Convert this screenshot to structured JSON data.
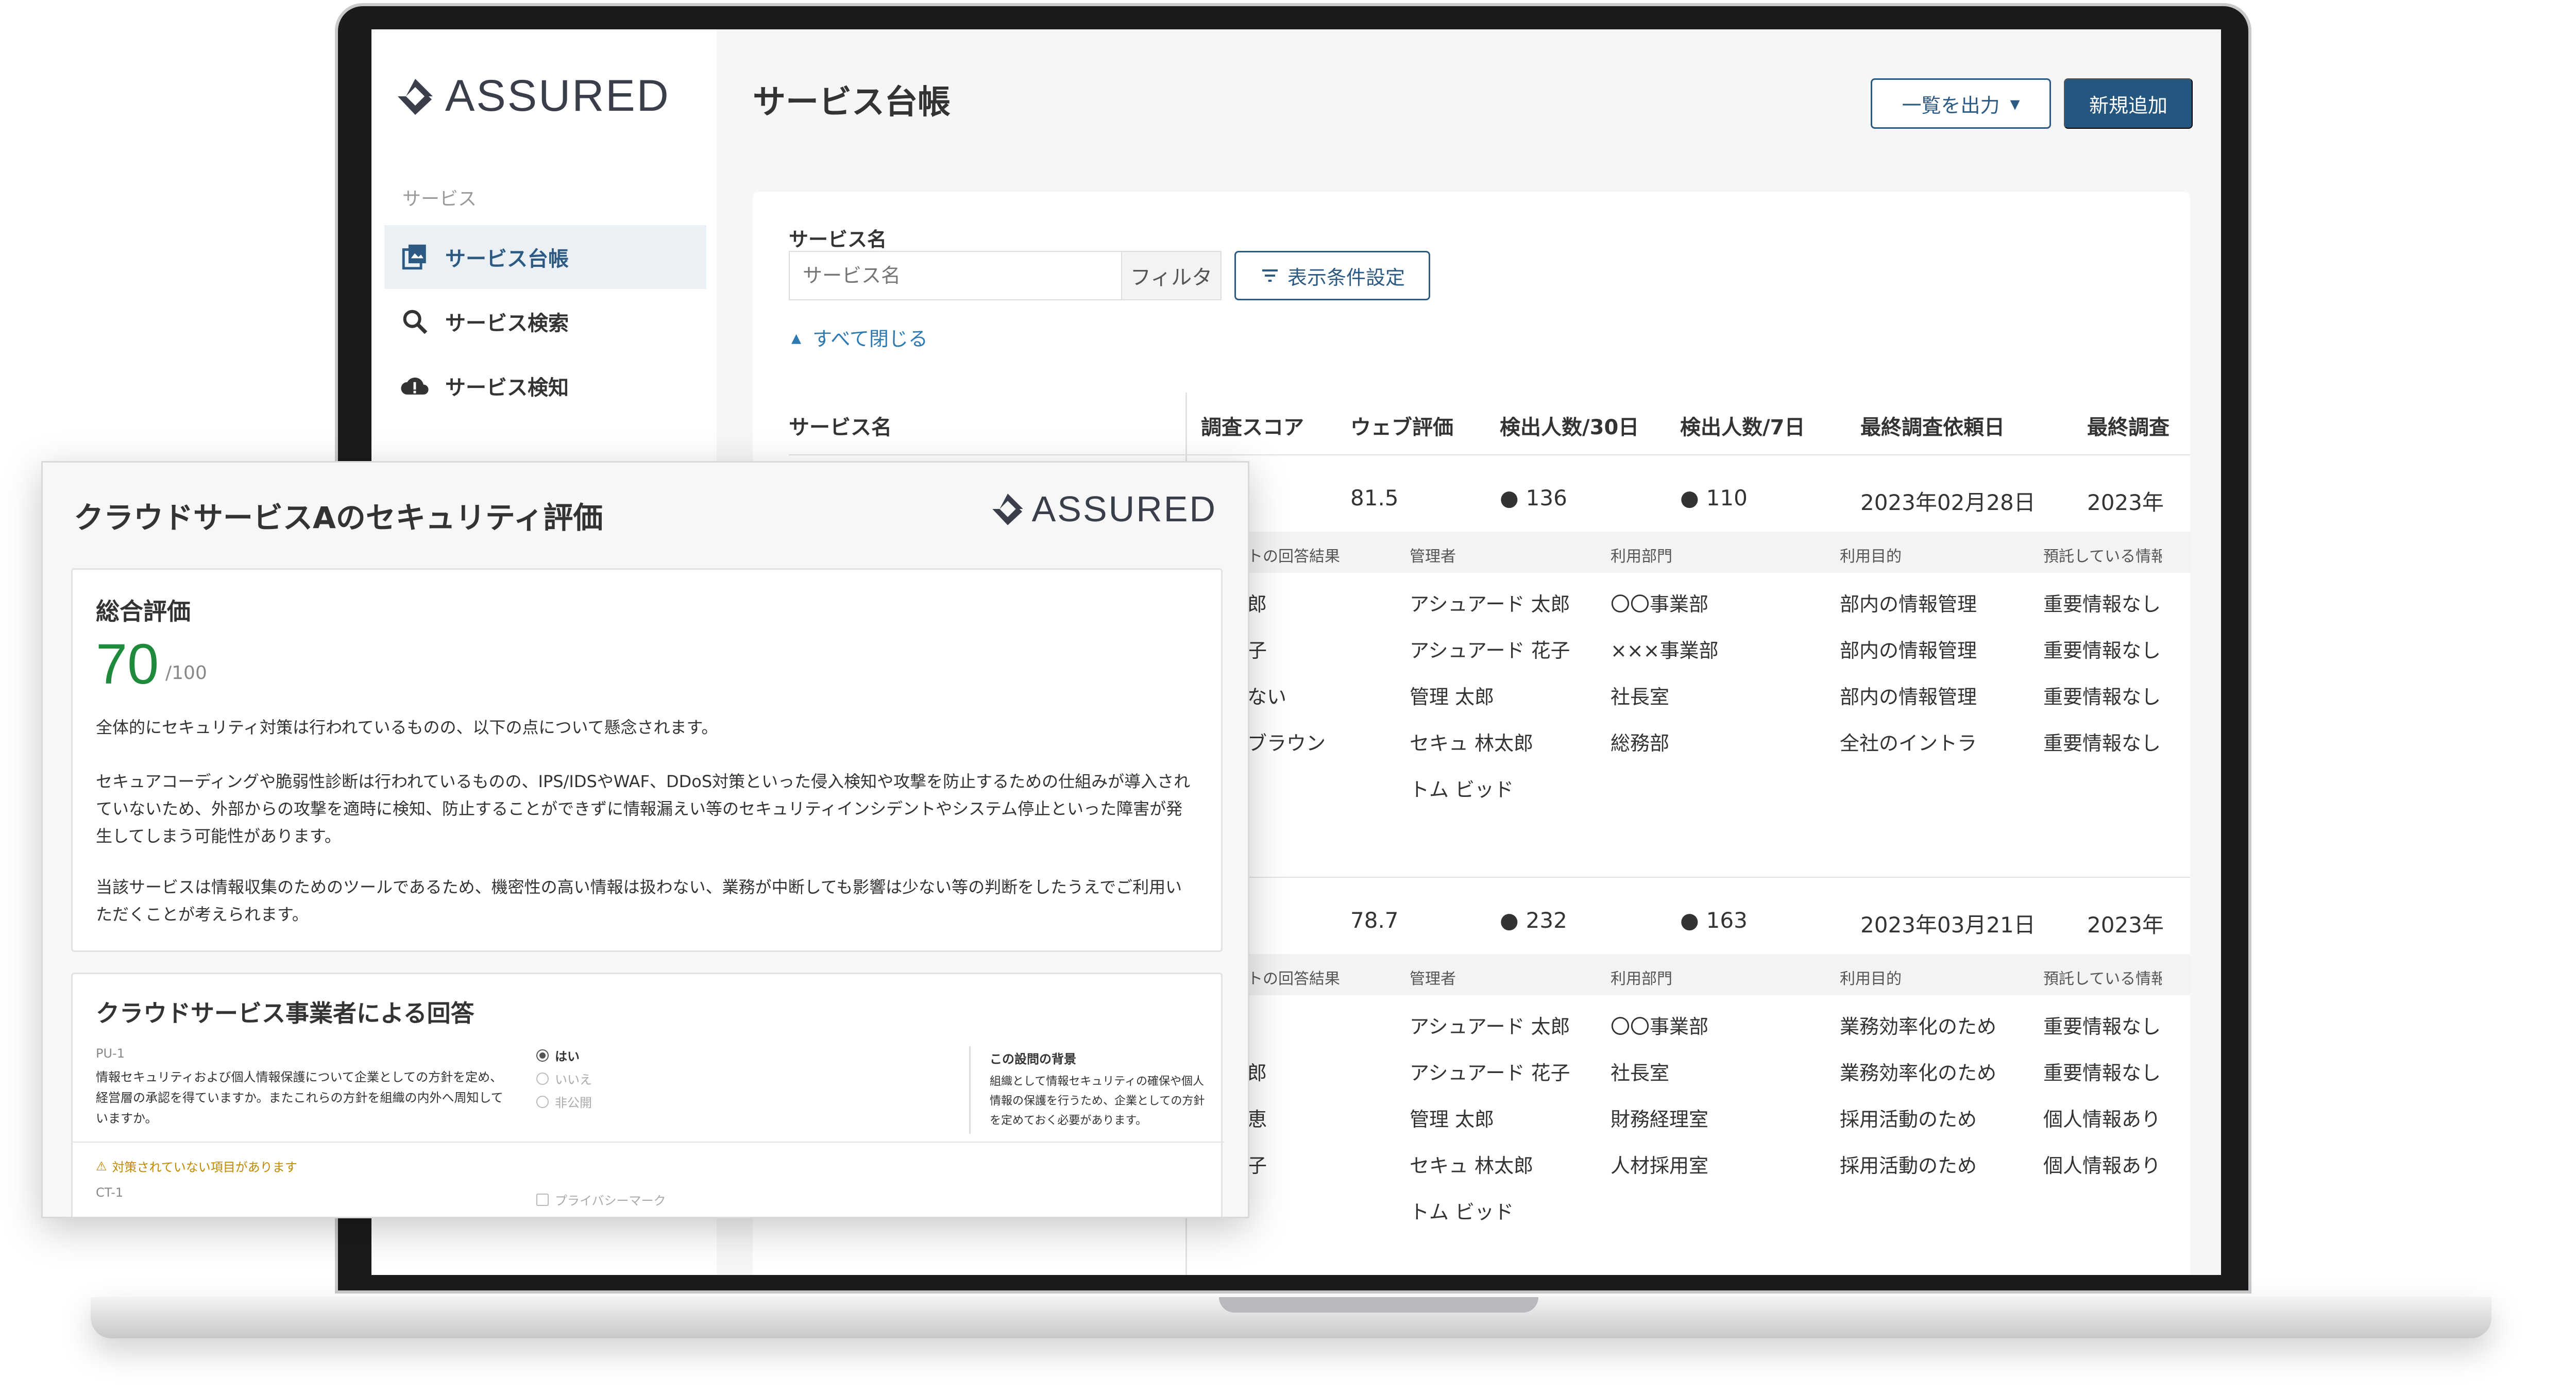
{
  "app": {
    "logo_text": "ASSURED",
    "accent_color": "#25567f",
    "success_color": "#1f8a3c"
  },
  "sidebar": {
    "section_label": "サービス",
    "items": [
      {
        "label": "サービス台帳",
        "icon": "ledger-icon",
        "active": true
      },
      {
        "label": "サービス検索",
        "icon": "search-icon",
        "active": false
      },
      {
        "label": "サービス検知",
        "icon": "cloud-alert-icon",
        "active": false
      }
    ]
  },
  "header": {
    "title": "サービス台帳",
    "export_label": "一覧を出力",
    "new_label": "新規追加"
  },
  "filter": {
    "label": "サービス名",
    "placeholder": "サービス名",
    "filter_button": "フィルタ",
    "display_settings": "表示条件設定",
    "collapse_all": "すべて閉じる"
  },
  "table": {
    "headers": [
      "サービス名",
      "調査スコア",
      "ウェブ評価",
      "検出人数/30日",
      "検出人数/7日",
      "最終調査依頼日",
      "最終調査"
    ],
    "rows": [
      {
        "web": "81.5",
        "det30": "136",
        "det7": "110",
        "last_request": "2023年02月28日",
        "last_survey": "2023年",
        "sub_headers": [
          "トの回答結果",
          "管理者",
          "利用部門",
          "利用目的",
          "預託している情報"
        ],
        "sub_rows": [
          [
            "郎",
            "アシュアード 太郎",
            "〇〇事業部",
            "部内の情報管理",
            "重要情報なし"
          ],
          [
            "子",
            "アシュアード 花子",
            "×××事業部",
            "部内の情報管理",
            "重要情報なし"
          ],
          [
            "ない",
            "管理 太郎",
            "社長室",
            "部内の情報管理",
            "重要情報なし"
          ],
          [
            "ブラウン",
            "セキュ 林太郎",
            "総務部",
            "全社のイントラ",
            "重要情報なし"
          ],
          [
            "",
            "トム ビッド",
            "",
            "",
            ""
          ]
        ]
      },
      {
        "web": "78.7",
        "det30": "232",
        "det7": "163",
        "last_request": "2023年03月21日",
        "last_survey": "2023年",
        "sub_headers": [
          "トの回答結果",
          "管理者",
          "利用部門",
          "利用目的",
          "預託している情報"
        ],
        "sub_rows": [
          [
            "",
            "アシュアード 太郎",
            "〇〇事業部",
            "業務効率化のため",
            "重要情報なし"
          ],
          [
            "郎",
            "アシュアード 花子",
            "社長室",
            "業務効率化のため",
            "重要情報なし"
          ],
          [
            "恵",
            "管理 太郎",
            "財務経理室",
            "採用活動のため",
            "個人情報あり"
          ],
          [
            "子",
            "セキュ 林太郎",
            "人材採用室",
            "採用活動のため",
            "個人情報あり"
          ],
          [
            "",
            "トム ビッド",
            "",
            "",
            ""
          ]
        ]
      }
    ]
  },
  "report": {
    "title": "クラウドサービスAのセキュリティ評価",
    "overall_label": "総合評価",
    "score": "70",
    "score_max": "/100",
    "paragraphs": [
      "全体的にセキュリティ対策は行われているものの、以下の点について懸念されます。",
      "セキュアコーディングや脆弱性診断は行われているものの、IPS/IDSやWAF、DDoS対策といった侵入検知や攻撃を防止するための仕組みが導入されていないため、外部からの攻撃を適時に検知、防止することができずに情報漏えい等のセキュリティインシデントやシステム停止といった障害が発生してしまう可能性があります。",
      "当該サービスは情報収集のためのツールであるため、機密性の高い情報は扱わない、業務が中断しても影響は少ない等の判断をしたうえでご利用いただくことが考えられます。"
    ],
    "answers_title": "クラウドサービス事業者による回答",
    "question": {
      "id": "PU-1",
      "text": "情報セキュリティおよび個人情報保護について企業としての方針を定め、経営層の承認を得ていますか。またこれらの方針を組織の内外へ周知していますか。",
      "options": [
        "はい",
        "いいえ",
        "非公開"
      ],
      "selected": "はい",
      "background_title": "この設問の背景",
      "background_text": "組織として情報セキュリティの確保や個人情報の保護を行うため、企業としての方針を定めておく必要があります。"
    },
    "warning": "対策されていない項目があります",
    "next_question": {
      "id": "CT-1",
      "option": "プライバシーマーク"
    }
  }
}
